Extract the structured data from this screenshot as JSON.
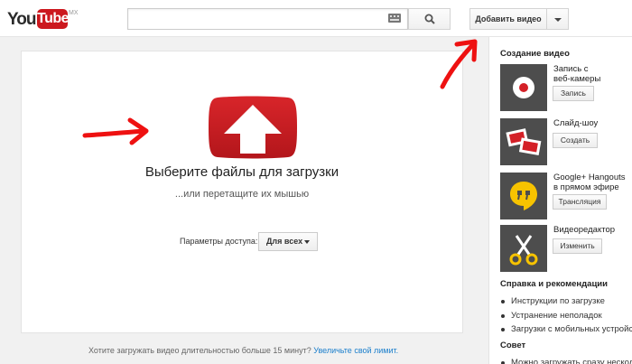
{
  "header": {
    "logo_you": "You",
    "logo_tube": "Tube",
    "logo_region": "MX",
    "search_placeholder": "",
    "upload_button": "Добавить видео"
  },
  "upload": {
    "title": "Выберите файлы для загрузки",
    "subtitle": "...или перетащите их мышью",
    "access_label": "Параметры доступа:",
    "access_value": "Для всех"
  },
  "footer": {
    "question": "Хотите загружать видео длительностью больше 15 минут?",
    "link": "Увеличьте свой лимит."
  },
  "sidebar": {
    "create_heading": "Создание видео",
    "tools": [
      {
        "title_1": "Запись с",
        "title_2": "веб-камеры",
        "button": "Запись",
        "icon": "webcam-record-icon"
      },
      {
        "title_1": "Слайд-шоу",
        "title_2": "",
        "button": "Создать",
        "icon": "slideshow-icon"
      },
      {
        "title_1": "Google+ Hangouts",
        "title_2": "в прямом эфире",
        "button": "Трансляция",
        "icon": "hangouts-icon"
      },
      {
        "title_1": "Видеоредактор",
        "title_2": "",
        "button": "Изменить",
        "icon": "scissors-icon"
      }
    ],
    "help_heading": "Справка и рекомендации",
    "help_items": [
      "Инструкции по загрузке",
      "Устранение неполадок",
      "Загрузки с мобильных устройств"
    ],
    "tip_heading": "Совет",
    "tip_text": "Можно загружать сразу несколько"
  },
  "colors": {
    "brand_red": "#cc181e",
    "annotation_red": "#ee1111",
    "link_blue": "#1b7fcc"
  }
}
